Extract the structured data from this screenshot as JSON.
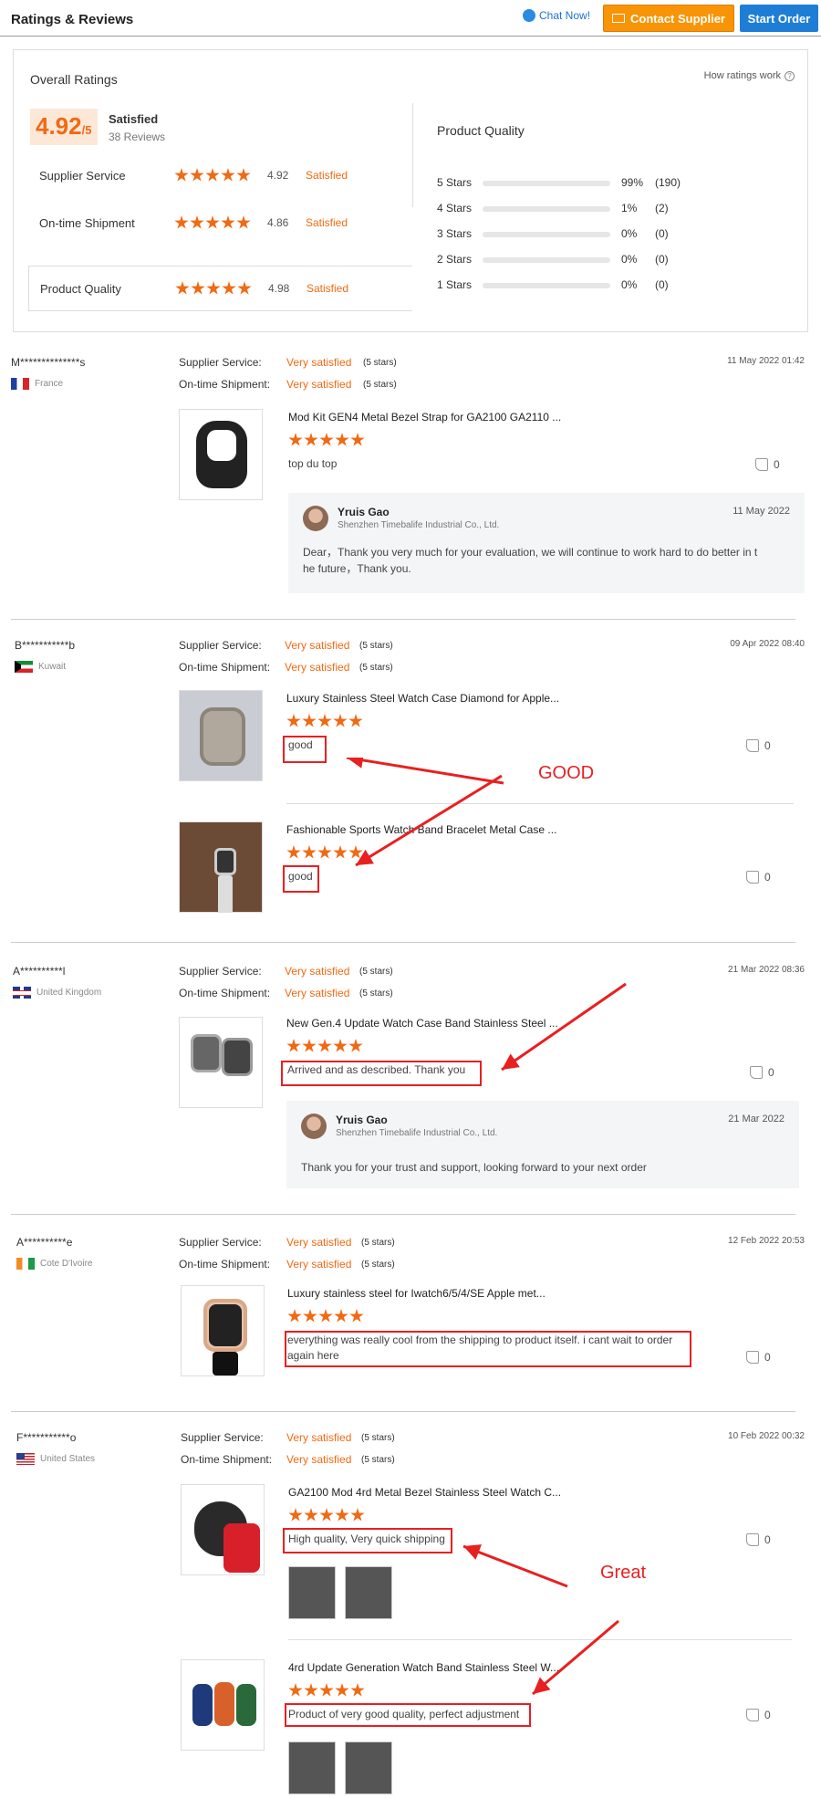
{
  "header": {
    "title": "Ratings & Reviews",
    "chat_label": "Chat Now!",
    "contact_label": "Contact Supplier",
    "start_label": "Start Order"
  },
  "overall": {
    "label": "Overall Ratings",
    "how_label": "How ratings work",
    "score": "4.92",
    "score_suffix": "/5",
    "satisfied": "Satisfied",
    "reviews_count": "38 Reviews",
    "rows": [
      {
        "name": "Supplier Service",
        "value": "4.92",
        "status": "Satisfied"
      },
      {
        "name": "On-time Shipment",
        "value": "4.86",
        "status": "Satisfied"
      },
      {
        "name": "Product Quality",
        "value": "4.98",
        "status": "Satisfied"
      }
    ],
    "quality_title": "Product Quality",
    "bars": [
      {
        "label": "5 Stars",
        "fraction": 0.99,
        "pct": "99%",
        "count": "(190)"
      },
      {
        "label": "4 Stars",
        "fraction": 0.01,
        "pct": "1%",
        "count": "(2)"
      },
      {
        "label": "3 Stars",
        "fraction": 0,
        "pct": "0%",
        "count": "(0)"
      },
      {
        "label": "2 Stars",
        "fraction": 0,
        "pct": "0%",
        "count": "(0)"
      },
      {
        "label": "1 Stars",
        "fraction": 0,
        "pct": "0%",
        "count": "(0)"
      }
    ],
    "accent_color": "#f06a14"
  },
  "labels": {
    "supplier_service": "Supplier Service:",
    "ontime_shipment": "On-time Shipment:",
    "very_satisfied": "Very satisfied",
    "five_stars": "(5 stars)"
  },
  "reviews": [
    {
      "user": "M**************s",
      "country": "France",
      "date": "11 May 2022 01:42",
      "products": [
        {
          "title": "Mod Kit GEN4 Metal Bezel Strap for GA2100 GA2110 ...",
          "comment": "top du top",
          "likes": "0"
        }
      ],
      "reply": {
        "name": "Yruis Gao",
        "company": "Shenzhen Timebalife Industrial Co., Ltd.",
        "date": "11 May 2022",
        "text_line1": "Dear，Thank you very much for your evaluation, we will continue to work hard to do better in t",
        "text_line2": "he future，Thank you."
      }
    },
    {
      "user": "B***********b",
      "country": "Kuwait",
      "date": "09 Apr 2022 08:40",
      "products": [
        {
          "title": "Luxury Stainless Steel Watch Case Diamond for Apple...",
          "comment": "good",
          "likes": "0"
        },
        {
          "title": "Fashionable Sports Watch Band Bracelet Metal Case ...",
          "comment": "good",
          "likes": "0"
        }
      ],
      "annotation": "GOOD"
    },
    {
      "user": "A**********l",
      "country": "United Kingdom",
      "date": "21 Mar 2022 08:36",
      "products": [
        {
          "title": "New Gen.4 Update Watch Case Band Stainless Steel ...",
          "comment": "Arrived and as described. Thank you",
          "likes": "0"
        }
      ],
      "reply": {
        "name": "Yruis Gao",
        "company": "Shenzhen Timebalife Industrial Co., Ltd.",
        "date": "21 Mar 2022",
        "text_line1": "Thank you for your trust and support, looking forward to your next order"
      }
    },
    {
      "user": "A**********e",
      "country": "Cote D'Ivoire",
      "date": "12 Feb 2022 20:53",
      "products": [
        {
          "title": "Luxury stainless steel for Iwatch6/5/4/SE Apple met...",
          "comment_line1": "everything was really cool from the shipping to product itself. i cant wait to order",
          "comment_line2": "again here",
          "likes": "0"
        }
      ]
    },
    {
      "user": "F***********o",
      "country": "United States",
      "date": "10 Feb 2022 00:32",
      "products": [
        {
          "title": "GA2100 Mod 4rd Metal Bezel Stainless Steel Watch C...",
          "comment": "High quality, Very quick shipping",
          "likes": "0"
        },
        {
          "title": "4rd Update Generation Watch Band Stainless Steel W...",
          "comment": "Product of very good quality, perfect adjustment",
          "likes": "0"
        }
      ],
      "annotation": "Great"
    }
  ]
}
